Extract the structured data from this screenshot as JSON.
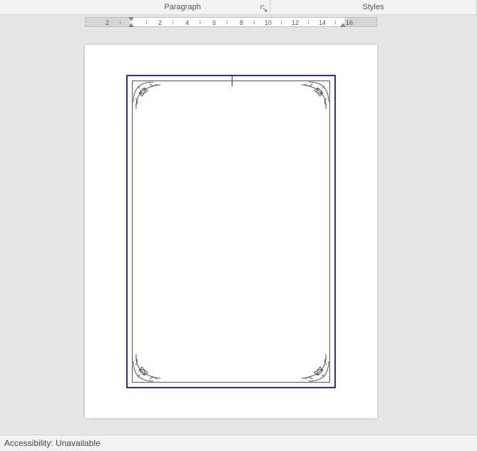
{
  "ribbon": {
    "groups": {
      "paragraph": "Paragraph",
      "styles": "Styles"
    }
  },
  "ruler": {
    "ticks": [
      "2",
      "2",
      "4",
      "6",
      "8",
      "10",
      "12",
      "14",
      "16"
    ]
  },
  "status": {
    "accessibility_label": "Accessibility:",
    "accessibility_value": "Unavailable"
  },
  "document": {
    "border_color": "#2a2f9e"
  }
}
